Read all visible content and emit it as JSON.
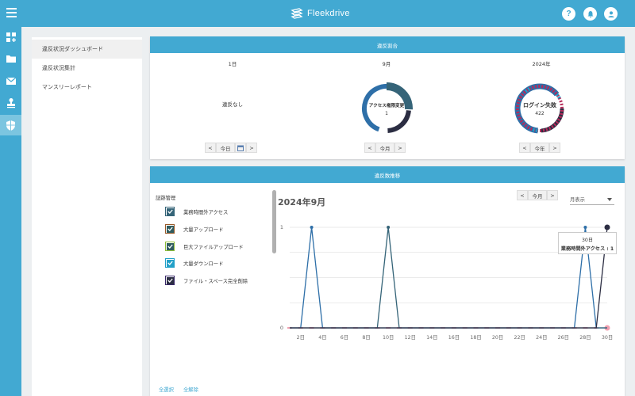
{
  "app": {
    "brand": "Fleekdrive"
  },
  "header": {
    "help_icon": "?",
    "icons": [
      "help-icon",
      "bell-icon",
      "user-icon"
    ]
  },
  "rail": {
    "icons": [
      "apps-add-icon",
      "folder-icon",
      "mail-icon",
      "stamp-icon",
      "shield-icon"
    ]
  },
  "nav": {
    "items": [
      {
        "label": "違反状況ダッシュボード",
        "active": true
      },
      {
        "label": "違反状況集計",
        "active": false
      },
      {
        "label": "マンスリーレポート",
        "active": false
      }
    ]
  },
  "summary": {
    "title": "違反割合",
    "day": {
      "label": "1日",
      "empty_text": "違反なし",
      "controls": {
        "prev": "<",
        "today": "今日",
        "next": ">"
      }
    },
    "month": {
      "label": "9月",
      "donut_title": "アクセス権限変更",
      "donut_value": "1",
      "controls": {
        "prev": "<",
        "today": "今月",
        "next": ">"
      }
    },
    "year": {
      "label": "2024年",
      "donut_title": "ログイン失敗",
      "donut_value": "422",
      "controls": {
        "prev": "<",
        "today": "今年",
        "next": ">"
      }
    }
  },
  "trend": {
    "title": "違反数推移",
    "legend_title": "証跡管理",
    "legend": [
      {
        "label": "業務時間外アクセス",
        "color": "#2e6fa8"
      },
      {
        "label": "大量アップロード",
        "color": "#9a5a2a"
      },
      {
        "label": "巨大ファイルアップロード",
        "color": "#8fbf3a"
      },
      {
        "label": "大量ダウンロード",
        "color": "#22a0c8"
      },
      {
        "label": "ファイル・スペース完全削除",
        "color": "#3a2a6a"
      }
    ],
    "controls": {
      "prev": "<",
      "today": "今月",
      "next": ">"
    },
    "view_select": "月表示",
    "select_all": "全選択",
    "deselect_all": "全解除",
    "tooltip": {
      "date": "30日",
      "text": "業務時間外アクセス : 1"
    }
  },
  "chart_data": {
    "type": "line",
    "title": "2024年9月",
    "x": [
      1,
      2,
      3,
      4,
      5,
      6,
      7,
      8,
      9,
      10,
      11,
      12,
      13,
      14,
      15,
      16,
      17,
      18,
      19,
      20,
      21,
      22,
      23,
      24,
      25,
      26,
      27,
      28,
      29,
      30
    ],
    "xticks": [
      "2日",
      "4日",
      "6日",
      "8日",
      "10日",
      "12日",
      "14日",
      "16日",
      "18日",
      "20日",
      "22日",
      "24日",
      "26日",
      "28日",
      "30日"
    ],
    "yticks": [
      "0",
      "1"
    ],
    "ylim": [
      0,
      1
    ],
    "series": [
      {
        "name": "業務時間外アクセス",
        "color": "#2e6fa8",
        "values": [
          0,
          0,
          1,
          0,
          0,
          0,
          0,
          0,
          0,
          0,
          0,
          0,
          0,
          0,
          0,
          0,
          0,
          0,
          0,
          0,
          0,
          0,
          0,
          0,
          0,
          0,
          0,
          1,
          0,
          0
        ]
      },
      {
        "name": "大量アップロード",
        "color": "#356478",
        "values": [
          0,
          0,
          0,
          0,
          0,
          0,
          0,
          0,
          0,
          1,
          0,
          0,
          0,
          0,
          0,
          0,
          0,
          0,
          0,
          0,
          0,
          0,
          0,
          0,
          0,
          0,
          0,
          0,
          0,
          0
        ]
      },
      {
        "name": "ファイル・スペース完全削除",
        "color": "#2b2d42",
        "values": [
          0,
          0,
          0,
          0,
          0,
          0,
          0,
          0,
          0,
          0,
          0,
          0,
          0,
          0,
          0,
          0,
          0,
          0,
          0,
          0,
          0,
          0,
          0,
          0,
          0,
          0,
          0,
          0,
          0,
          1
        ]
      }
    ]
  }
}
